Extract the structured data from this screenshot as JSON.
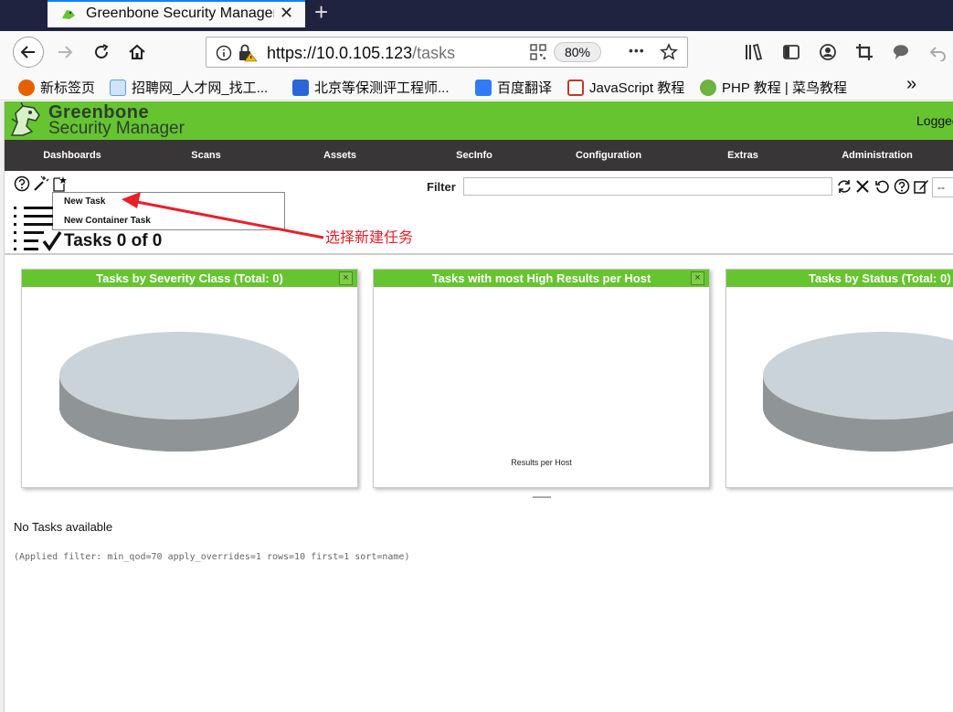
{
  "browser": {
    "tab_title": "Greenbone Security Manager",
    "tab_close": "✕",
    "new_tab": "+",
    "url_host": "https://10.0.105.123",
    "url_path": "/tasks",
    "zoom": "80%",
    "more_label": "•••",
    "bookmarks": [
      {
        "label": "新标签页",
        "color": "#e66000"
      },
      {
        "label": "招聘网_人才网_找工...",
        "color": "#5aa0e6"
      },
      {
        "label": "北京等保测评工程师...",
        "color": "#2b66d9"
      },
      {
        "label": "百度翻译",
        "color": "#2f7cf6"
      },
      {
        "label": "JavaScript 教程",
        "color": "#c0392b"
      },
      {
        "label": "PHP 教程 | 菜鸟教程",
        "color": "#6cb33f"
      }
    ],
    "bookmarks_overflow": "»"
  },
  "app": {
    "logo_name": "Greenbone",
    "logo_sub": "Security Manager",
    "logged_in": "Logged",
    "menu": [
      "Dashboards",
      "Scans",
      "Assets",
      "SecInfo",
      "Configuration",
      "Extras",
      "Administration"
    ],
    "dropdown": {
      "new_task": "New Task",
      "new_container_task": "New Container Task"
    },
    "filter_label": "Filter",
    "filter_value": "",
    "filter_select": "--",
    "page_title": "Tasks 0 of 0",
    "panels": [
      {
        "title": "Tasks by Severity Class (Total: 0)",
        "caption": ""
      },
      {
        "title": "Tasks with most High Results per Host",
        "caption": "Results per Host"
      },
      {
        "title": "Tasks by Status (Total: 0)",
        "caption": ""
      }
    ],
    "panel_close": "×",
    "no_tasks": "No Tasks available",
    "applied_filter": "(Applied filter: min_qod=70 apply_overrides=1 rows=10 first=1 sort=name)"
  },
  "annotation": {
    "text": "选择新建任务",
    "color": "#e8202a"
  },
  "colors": {
    "brand_green": "#66c430",
    "menu_bg": "#393637",
    "pie_top": "#c9d3d9",
    "pie_side": "#8f9496"
  }
}
